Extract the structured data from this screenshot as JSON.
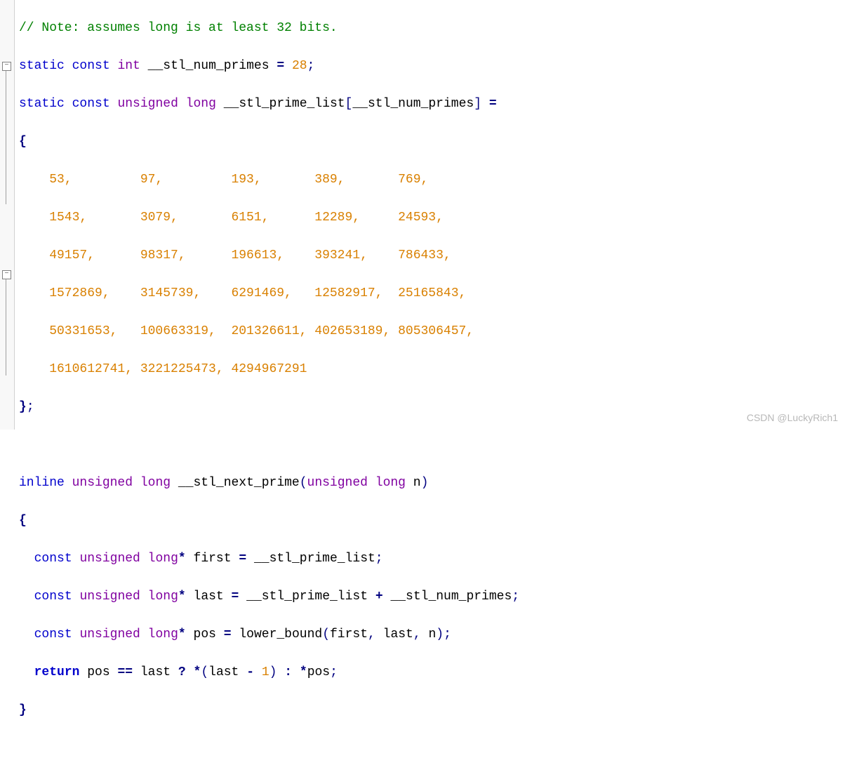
{
  "code": {
    "comment": "// Note: assumes long is at least 32 bits.",
    "l2_static": "static",
    "l2_const": "const",
    "l2_int": "int",
    "l2_ident": "__stl_num_primes",
    "l2_eq": "=",
    "l2_val": "28",
    "l2_semi": ";",
    "l3_static": "static",
    "l3_const": "const",
    "l3_unsigned": "unsigned",
    "l3_long": "long",
    "l3_ident": "__stl_prime_list",
    "l3_lbr": "[",
    "l3_idx": "__stl_num_primes",
    "l3_rbr": "]",
    "l3_eq": "=",
    "l4_brace": "{",
    "primes_row1": "    53,         97,         193,       389,       769,",
    "primes_row2": "    1543,       3079,       6151,      12289,     24593,",
    "primes_row3": "    49157,      98317,      196613,    393241,    786433,",
    "primes_row4": "    1572869,    3145739,    6291469,   12582917,  25165843,",
    "primes_row5": "    50331653,   100663319,  201326611, 402653189, 805306457,",
    "primes_row6": "    1610612741, 3221225473, 4294967291",
    "l11_brace": "}",
    "l11_semi": ";",
    "l13_inline": "inline",
    "l13_unsigned": "unsigned",
    "l13_long": "long",
    "l13_func": "__stl_next_prime",
    "l13_lp": "(",
    "l13_p_unsigned": "unsigned",
    "l13_p_long": "long",
    "l13_param": "n",
    "l13_rp": ")",
    "l14_brace": "{",
    "l15_const": "const",
    "l15_unsigned": "unsigned",
    "l15_long": "long",
    "l15_star": "*",
    "l15_var": "first",
    "l15_eq": "=",
    "l15_rhs": "__stl_prime_list",
    "l15_semi": ";",
    "l16_const": "const",
    "l16_unsigned": "unsigned",
    "l16_long": "long",
    "l16_star": "*",
    "l16_var": "last",
    "l16_eq": "=",
    "l16_rhs1": "__stl_prime_list",
    "l16_plus": "+",
    "l16_rhs2": "__stl_num_primes",
    "l16_semi": ";",
    "l17_const": "const",
    "l17_unsigned": "unsigned",
    "l17_long": "long",
    "l17_star": "*",
    "l17_var": "pos",
    "l17_eq": "=",
    "l17_func": "lower_bound",
    "l17_lp": "(",
    "l17_a1": "first",
    "l17_c1": ",",
    "l17_a2": "last",
    "l17_c2": ",",
    "l17_a3": "n",
    "l17_rp": ")",
    "l17_semi": ";",
    "l18_return": "return",
    "l18_pos": "pos",
    "l18_eqeq": "==",
    "l18_last": "last",
    "l18_q": "?",
    "l18_star1": "*",
    "l18_lp": "(",
    "l18_last2": "last",
    "l18_minus": "-",
    "l18_one": "1",
    "l18_rp": ")",
    "l18_colon": ":",
    "l18_star2": "*",
    "l18_pos2": "pos",
    "l18_semi": ";",
    "l19_brace": "}"
  },
  "watermark": "CSDN @LuckyRich1"
}
